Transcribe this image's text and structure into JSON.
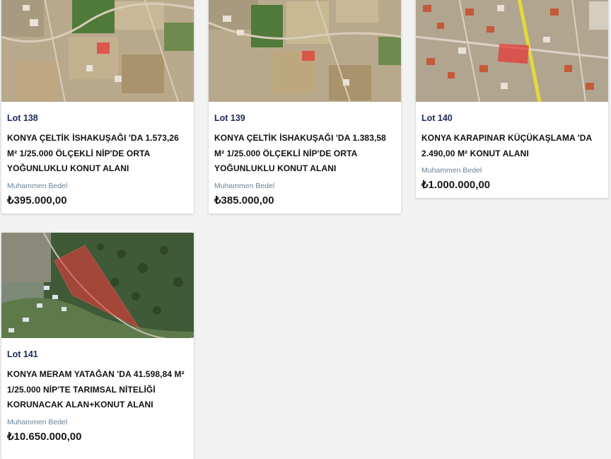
{
  "lots": [
    {
      "lot_label": "Lot 138",
      "title": "KONYA ÇELTİK İSHAKUŞAĞI 'DA 1.573,26 M² 1/25.000 ÖLÇEKLİ NİP'DE ORTA YOĞUNLUKLU KONUT ALANI",
      "price_label": "Muhammen Bedel",
      "price": "₺395.000,00"
    },
    {
      "lot_label": "Lot 139",
      "title": "KONYA ÇELTİK İSHAKUŞAĞI 'DA 1.383,58 M² 1/25.000 ÖLÇEKLİ NİP'DE ORTA YOĞUNLUKLU KONUT ALANI",
      "price_label": "Muhammen Bedel",
      "price": "₺385.000,00"
    },
    {
      "lot_label": "Lot 140",
      "title": "KONYA KARAPINAR KÜÇÜKAŞLAMA 'DA 2.490,00 M² KONUT ALANI",
      "price_label": "Muhammen Bedel",
      "price": "₺1.000.000,00"
    },
    {
      "lot_label": "Lot 141",
      "title": "KONYA MERAM YATAĞAN 'DA 41.598,84 M² 1/25.000 NİP'TE TARIMSAL NİTELİĞİ KORUNACAK ALAN+KONUT ALANI",
      "price_label": "Muhammen Bedel",
      "price": "₺10.650.000,00"
    }
  ],
  "colors": {
    "lot_label": "#1d2a5b",
    "muted": "#6a8196",
    "parcel_highlight": "#e53a3a",
    "background": "#f2f2f2"
  }
}
